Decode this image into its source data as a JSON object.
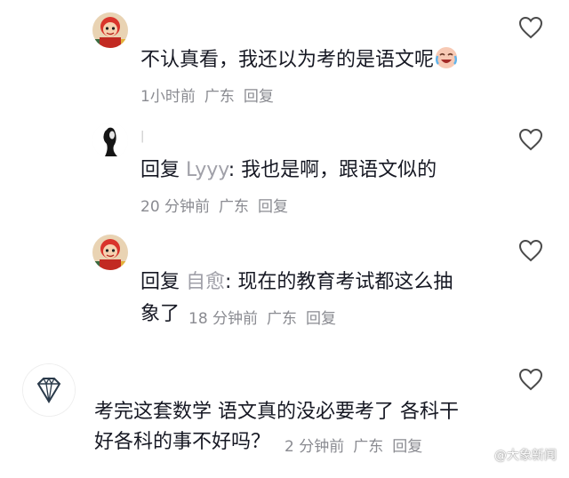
{
  "comments": [
    {
      "text": "不认真看，我还以为考的是语文呢",
      "emoji": "laughing-crying-emoji",
      "time": "1小时前",
      "location": "广东",
      "reply_label": "回复",
      "avatar": "cartoon-character-avatar"
    },
    {
      "username": "|",
      "reply_prefix": "回复",
      "reply_to": "Lyyy",
      "text": ": 我也是啊，跟语文似的",
      "time": "20 分钟前",
      "location": "广东",
      "reply_label": "回复",
      "avatar": "dark-silhouette-avatar"
    },
    {
      "reply_prefix": "回复",
      "reply_to": "自愈",
      "text_line1": ": 现在的教育考试都这么抽",
      "text_line2": "象了",
      "time": "18 分钟前",
      "location": "广东",
      "reply_label": "回复",
      "avatar": "cartoon-character-avatar"
    },
    {
      "text_line1": "考完这套数学 语文真的没必要考了 各科干",
      "text_line2": "好各科的事不好吗？",
      "time": "2 分钟前",
      "location": "广东",
      "reply_label": "回复",
      "avatar": "diamond-avatar"
    }
  ],
  "watermark": {
    "text": "@大象新闻"
  },
  "colors": {
    "text": "#161823",
    "meta": "#8a8b91",
    "reply_user": "#a0a0a8",
    "heart_stroke": "#4a4a4a"
  }
}
